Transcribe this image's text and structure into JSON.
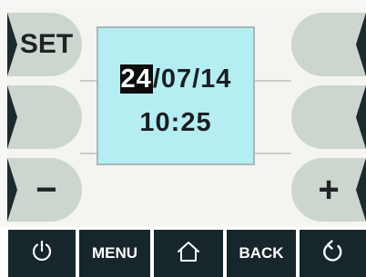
{
  "side_keys": {
    "top_left_label": "SET",
    "bottom_left_label": "−",
    "bottom_right_label": "+"
  },
  "display": {
    "date_day": "24",
    "date_rest": "/07/14",
    "time": "10:25"
  },
  "bottom_bar": {
    "power_icon": "power-icon",
    "menu_label": "MENU",
    "home_icon": "home-icon",
    "back_label": "BACK",
    "refresh_icon": "refresh-icon"
  },
  "colors": {
    "lcd_background": "#b4eef2",
    "key_fill": "#cdd5cf",
    "bar_dark": "#17262a",
    "highlight": "#0d0d0d"
  }
}
